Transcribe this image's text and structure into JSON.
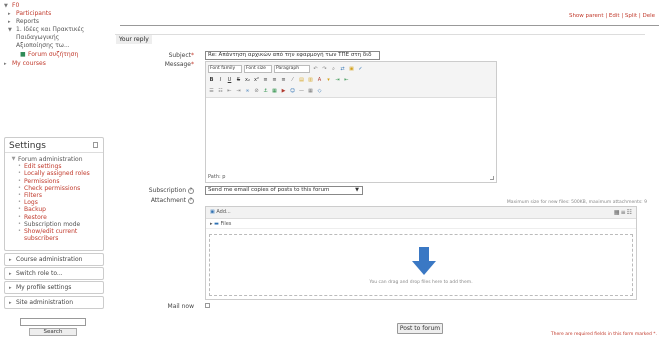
{
  "nav": {
    "items": [
      {
        "label": "F0",
        "tri": "▼",
        "indent": 0,
        "style": "link"
      },
      {
        "label": "Participants",
        "tri": "▸",
        "indent": 1,
        "style": "link"
      },
      {
        "label": "Reports",
        "tri": "▸",
        "indent": 1,
        "style": "dark"
      },
      {
        "label": "1. Ιδέες και Πρακτικές Παιδαγωγικής Αξιοποίησης τω...",
        "tri": "▼",
        "indent": 1,
        "style": "dark"
      },
      {
        "label": "Forum συζήτηση",
        "tri": "",
        "indent": 2,
        "style": "link"
      },
      {
        "label": "My courses",
        "tri": "▸",
        "indent": 0,
        "style": "link"
      }
    ]
  },
  "settings": {
    "title": "Settings",
    "group_title": "Forum administration",
    "items": [
      "Edit settings",
      "Locally assigned roles",
      "Permissions",
      "Check permissions",
      "Filters",
      "Logs",
      "Backup",
      "Restore",
      "Subscription mode",
      "Show/edit current subscribers"
    ]
  },
  "collapsed_blocks": [
    "Course administration",
    "Switch role to...",
    "My profile settings",
    "Site administration"
  ],
  "search": {
    "button": "Search"
  },
  "parent_links": "Show parent | Edit | Split | Dele",
  "form": {
    "legend": "Your reply",
    "subject_label": "Subject",
    "subject_value": "Re: Απάντηση αρχικών από την εφαρμογή των ΤΠΕ στη διδ",
    "message_label": "Message",
    "editor": {
      "font_family": "Font family",
      "font_size": "Font size",
      "paragraph": "Paragraph",
      "path": "Path: p"
    },
    "subscription_label": "Subscription",
    "subscription_value": "Send me email copies of posts to this forum",
    "attachment_label": "Attachment",
    "max_size": "Maximum size for new files: 500KB, maximum attachments: 9",
    "fm_add": "Add...",
    "fm_path": "Files",
    "fm_drop_text": "You can drag and drop files here to add them.",
    "mailnow_label": "Mail now",
    "submit": "Post to forum",
    "required_note": "There are required fields in this form marked *."
  },
  "colors": {
    "link": "#c0392b",
    "upload_arrow": "#3a78c4"
  }
}
